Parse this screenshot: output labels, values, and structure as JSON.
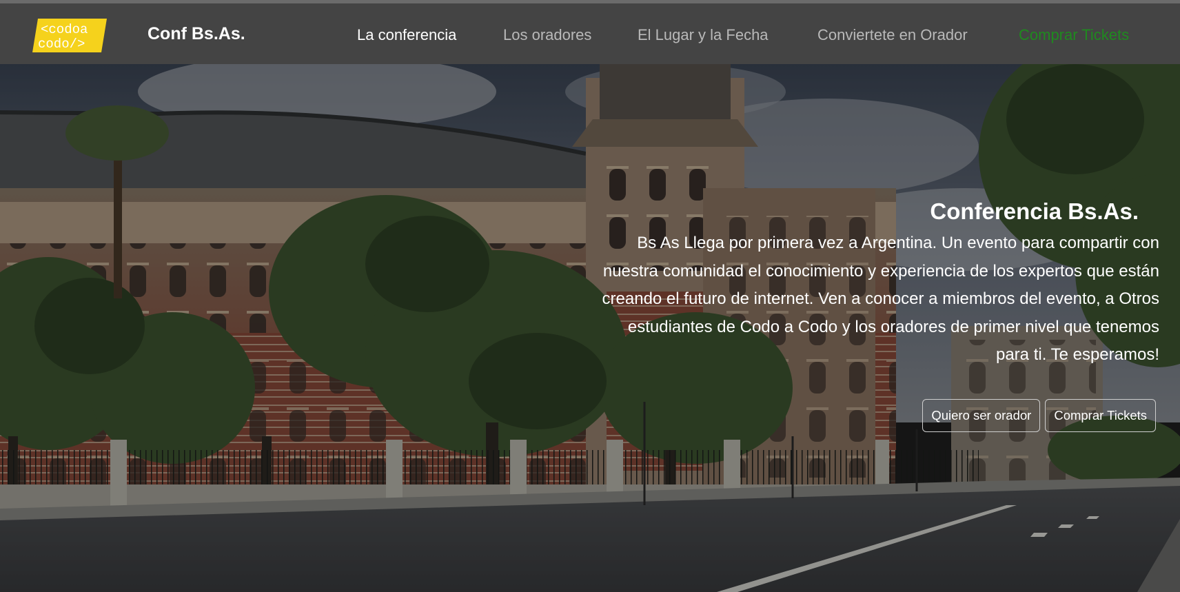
{
  "brand": {
    "logo_text_line1": "<codoa",
    "logo_text_line2": "codo/>",
    "title": "Conf Bs.As."
  },
  "nav": {
    "items": [
      {
        "label": "La conferencia",
        "state": "active"
      },
      {
        "label": "Los oradores",
        "state": "default"
      },
      {
        "label": "El Lugar y la Fecha",
        "state": "default"
      },
      {
        "label": "Conviertete en Orador",
        "state": "default"
      },
      {
        "label": "Comprar Tickets",
        "state": "highlight"
      }
    ]
  },
  "hero": {
    "title": "Conferencia Bs.As.",
    "description": "Bs As Llega por primera vez a Argentina. Un evento para compartir con nuestra comunidad el conocimiento y experiencia de los expertos que están creando el futuro de internet. Ven a conocer a miembros del evento, a Otros estudiantes de Codo a Codo y los oradores de primer nivel que tenemos para ti. Te esperamos!",
    "buttons": {
      "speaker": "Quiero ser orador",
      "tickets": "Comprar Tickets"
    }
  },
  "colors": {
    "navbar_bg": "#444444",
    "logo_yellow": "#f5d21c",
    "nav_active": "#ffffff",
    "nav_default": "#b9b9b9",
    "nav_tickets": "#1f8a1f"
  }
}
